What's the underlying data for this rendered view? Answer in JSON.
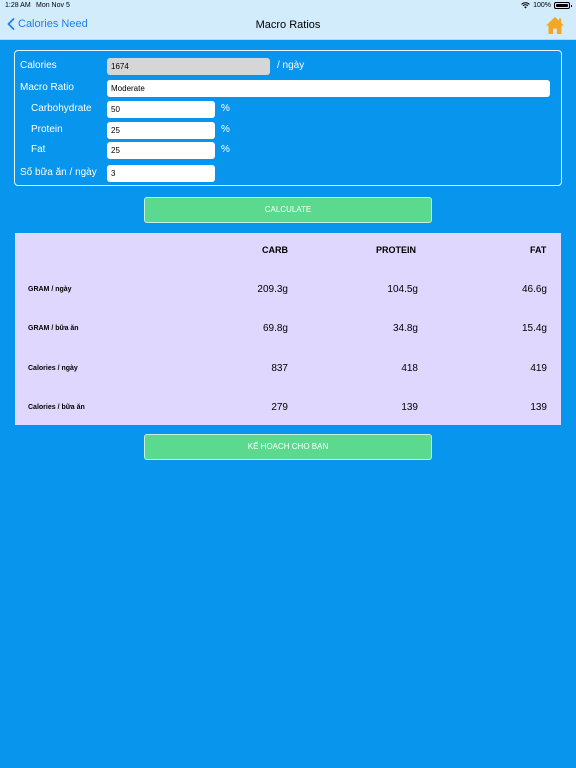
{
  "status": {
    "time": "1:28 AM",
    "date": "Mon Nov 5",
    "battery": "100%"
  },
  "nav": {
    "back_label": "Calories Need",
    "title": "Macro Ratios"
  },
  "form": {
    "calories_label": "Calories",
    "calories_value": "1674",
    "calories_suffix": "/ ngày",
    "macro_ratio_label": "Macro Ratio",
    "macro_ratio_value": "Moderate",
    "carb_label": "Carbohydrate",
    "carb_value": "50",
    "protein_label": "Protein",
    "protein_value": "25",
    "fat_label": "Fat",
    "fat_value": "25",
    "percent": "%",
    "meals_label": "Số bữa ăn / ngày",
    "meals_value": "3"
  },
  "buttons": {
    "calculate": "CALCULATE",
    "plan": "KẾ HOẠCH CHO BẠN"
  },
  "results": {
    "headers": [
      "CARB",
      "PROTEIN",
      "FAT"
    ],
    "rows": [
      {
        "label": "GRAM / ngày",
        "values": [
          "209.3g",
          "104.5g",
          "46.6g"
        ]
      },
      {
        "label": "GRAM / bữa ăn",
        "values": [
          "69.8g",
          "34.8g",
          "15.4g"
        ]
      },
      {
        "label": "Calories / ngày",
        "values": [
          "837",
          "418",
          "419"
        ]
      },
      {
        "label": "Calories / bữa ăn",
        "values": [
          "279",
          "139",
          "139"
        ]
      }
    ]
  },
  "colors": {
    "background": "#0895ee",
    "navbar": "#d3ecfb",
    "button": "#5ad98f",
    "results_bg": "#dfd7fd",
    "link": "#1e7ff0",
    "home_icon": "#f5a623"
  }
}
